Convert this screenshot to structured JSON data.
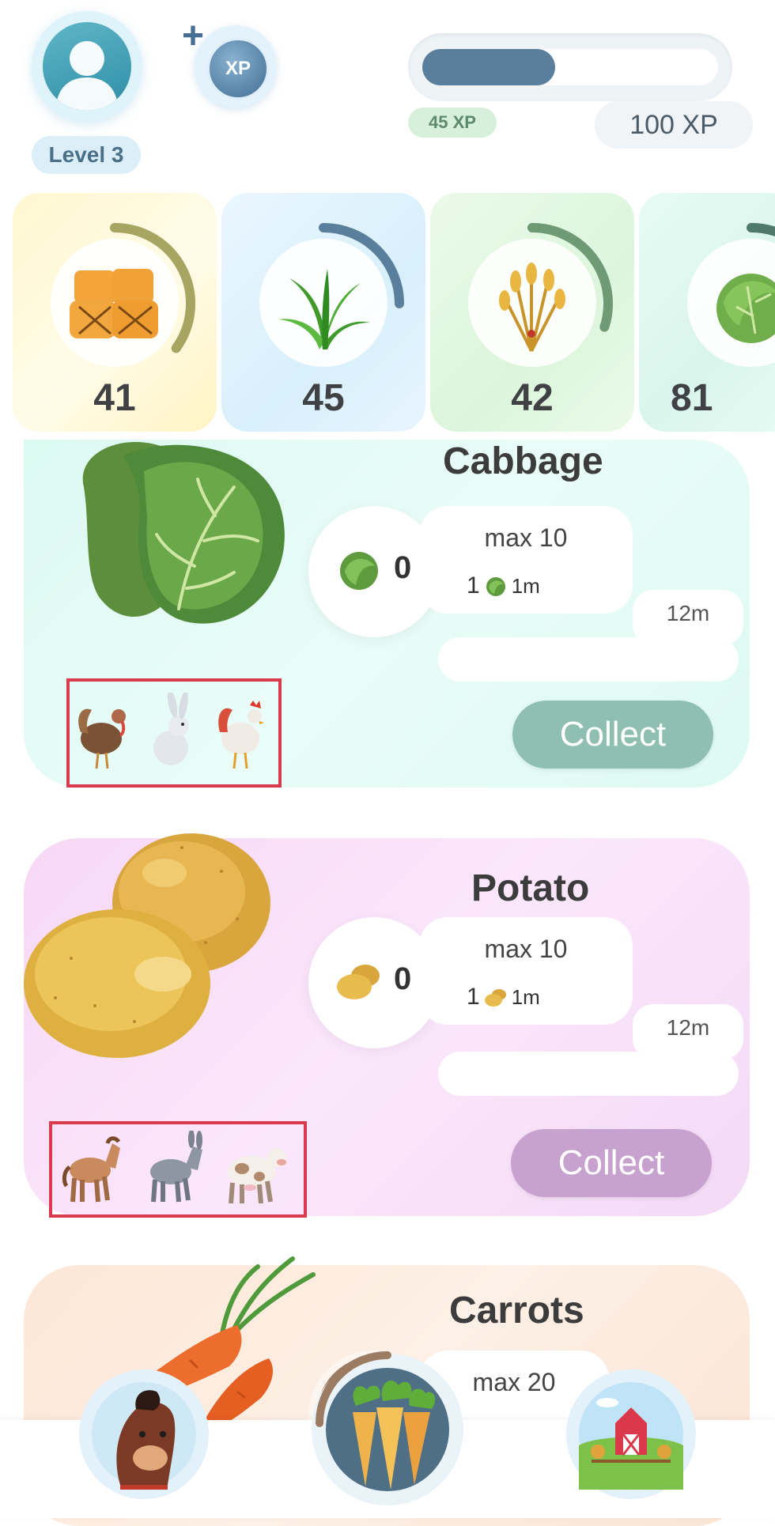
{
  "header": {
    "level_label": "Level 3",
    "xp_bonus_label": "XP",
    "xp_current_label": "45 XP",
    "xp_max_label": "100 XP",
    "xp_progress": 0.45
  },
  "resources": [
    {
      "name": "hay-bales",
      "count": "41",
      "progress": 0.35,
      "color": "#a7a562"
    },
    {
      "name": "grass",
      "count": "45",
      "progress": 0.25,
      "color": "#5a7f9c"
    },
    {
      "name": "wheat",
      "count": "42",
      "progress": 0.3,
      "color": "#6e9a74"
    },
    {
      "name": "cabbage",
      "count": "81",
      "progress": 0.4,
      "color": "#4f7a6b"
    }
  ],
  "crops": [
    {
      "title": "Cabbage",
      "stock": "0",
      "max_label": "max 10",
      "rate_amount": "1",
      "rate_unit": "1m",
      "timer": "12m",
      "collect_label": "Collect",
      "accent": "#8fbfb1"
    },
    {
      "title": "Potato",
      "stock": "0",
      "max_label": "max 10",
      "rate_amount": "1",
      "rate_unit": "1m",
      "timer": "12m",
      "collect_label": "Collect",
      "accent": "#c7a2cf"
    },
    {
      "title": "Carrots",
      "max_label": "max 20"
    }
  ],
  "nav": {
    "left": "horse-icon",
    "center": "carrots-icon",
    "right": "barn-icon"
  }
}
